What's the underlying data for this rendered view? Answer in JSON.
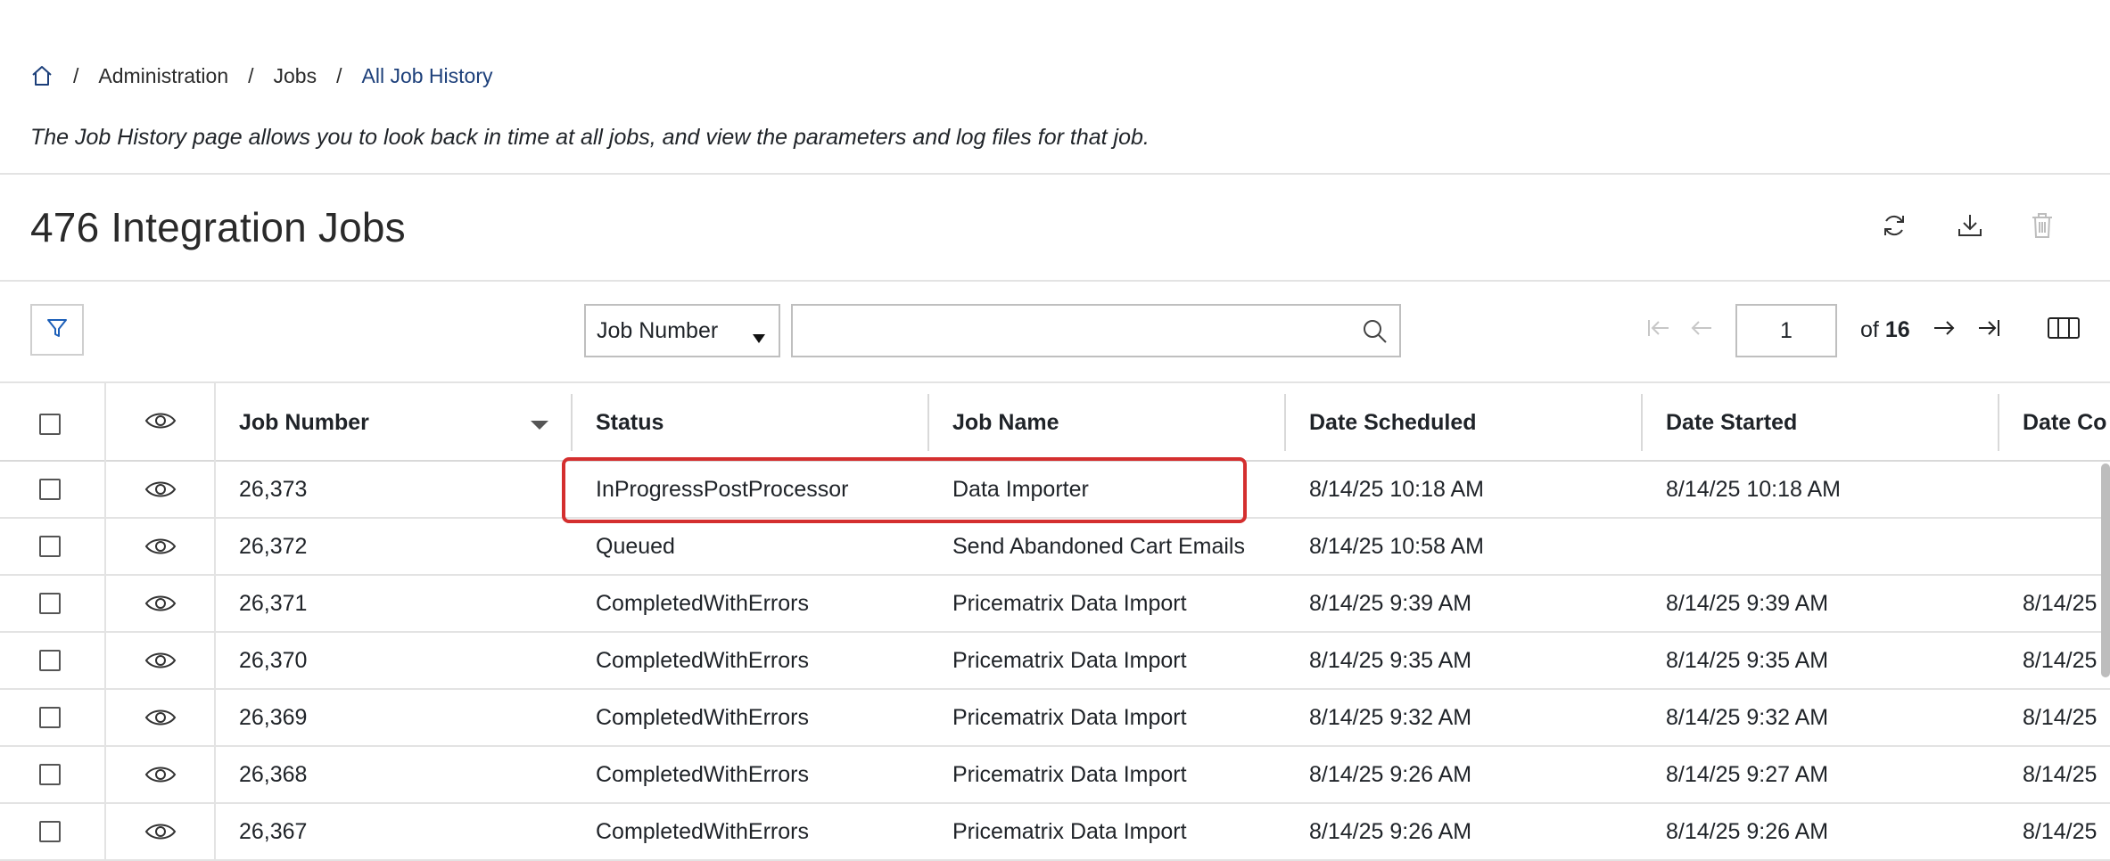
{
  "breadcrumb": {
    "items": [
      "Administration",
      "Jobs",
      "All Job History"
    ]
  },
  "description": "The Job History page allows you to look back in time at all jobs, and view the parameters and log files for that job.",
  "page_title": "476 Integration Jobs",
  "icons": {
    "home": "home-icon",
    "refresh": "refresh-icon",
    "download": "download-icon",
    "delete": "trash-icon",
    "filter": "filter-icon",
    "search": "search-icon",
    "columns": "columns-icon"
  },
  "toolbar": {
    "search_field": "Job Number",
    "search_value": ""
  },
  "pager": {
    "current_page": "1",
    "of_label": "of",
    "total_pages": "16"
  },
  "table": {
    "headers": [
      "Job Number",
      "Status",
      "Job Name",
      "Date Scheduled",
      "Date Started",
      "Date Co"
    ],
    "rows": [
      [
        "26,373",
        "InProgressPostProcessor",
        "Data Importer",
        "8/14/25 10:18 AM",
        "8/14/25 10:18 AM",
        ""
      ],
      [
        "26,372",
        "Queued",
        "Send Abandoned Cart Emails",
        "8/14/25 10:58 AM",
        "",
        ""
      ],
      [
        "26,371",
        "CompletedWithErrors",
        "Pricematrix Data Import",
        "8/14/25 9:39 AM",
        "8/14/25 9:39 AM",
        "8/14/25"
      ],
      [
        "26,370",
        "CompletedWithErrors",
        "Pricematrix Data Import",
        "8/14/25 9:35 AM",
        "8/14/25 9:35 AM",
        "8/14/25"
      ],
      [
        "26,369",
        "CompletedWithErrors",
        "Pricematrix Data Import",
        "8/14/25 9:32 AM",
        "8/14/25 9:32 AM",
        "8/14/25"
      ],
      [
        "26,368",
        "CompletedWithErrors",
        "Pricematrix Data Import",
        "8/14/25 9:26 AM",
        "8/14/25 9:27 AM",
        "8/14/25"
      ],
      [
        "26,367",
        "CompletedWithErrors",
        "Pricematrix Data Import",
        "8/14/25 9:26 AM",
        "8/14/25 9:26 AM",
        "8/14/25"
      ]
    ]
  },
  "colors": {
    "accent": "#1c3f7a",
    "highlight": "#d42f2f",
    "border": "#e3e3e3"
  }
}
